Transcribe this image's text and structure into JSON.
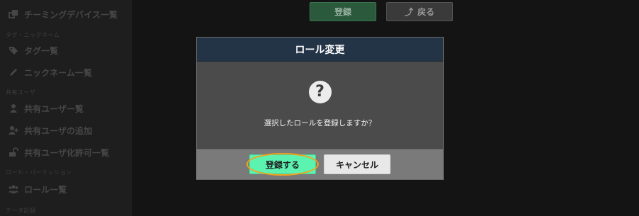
{
  "sidebar": {
    "items": [
      {
        "type": "item",
        "label": "チーミングデバイス一覧",
        "icon": "devices-icon"
      },
      {
        "type": "heading",
        "label": "タグ・ニックネーム"
      },
      {
        "type": "item",
        "label": "タグ一覧",
        "icon": "tags-icon"
      },
      {
        "type": "item",
        "label": "ニックネーム一覧",
        "icon": "pencil-icon"
      },
      {
        "type": "heading",
        "label": "共有ユーザ"
      },
      {
        "type": "item",
        "label": "共有ユーザー覧",
        "icon": "user-icon"
      },
      {
        "type": "item",
        "label": "共有ユーザの追加",
        "icon": "user-plus-icon"
      },
      {
        "type": "item",
        "label": "共有ユーザ化許可一覧",
        "icon": "unlock-icon"
      },
      {
        "type": "heading",
        "label": "ロール・パーミッション"
      },
      {
        "type": "item",
        "label": "ロール一覧",
        "icon": "users-icon"
      },
      {
        "type": "heading",
        "label": "データ記録"
      }
    ]
  },
  "toolbar": {
    "register_label": "登録",
    "back_label": "戻る",
    "back_icon": "back-arrow-icon"
  },
  "modal": {
    "title": "ロール変更",
    "icon": "question-icon",
    "icon_glyph": "?",
    "message": "選択したロールを登録しますか？",
    "confirm_label": "登録する",
    "cancel_label": "キャンセル"
  },
  "colors": {
    "modal_header": "#243447",
    "confirm_button": "#5cf3b1",
    "highlight_ring": "#f3a11c"
  }
}
